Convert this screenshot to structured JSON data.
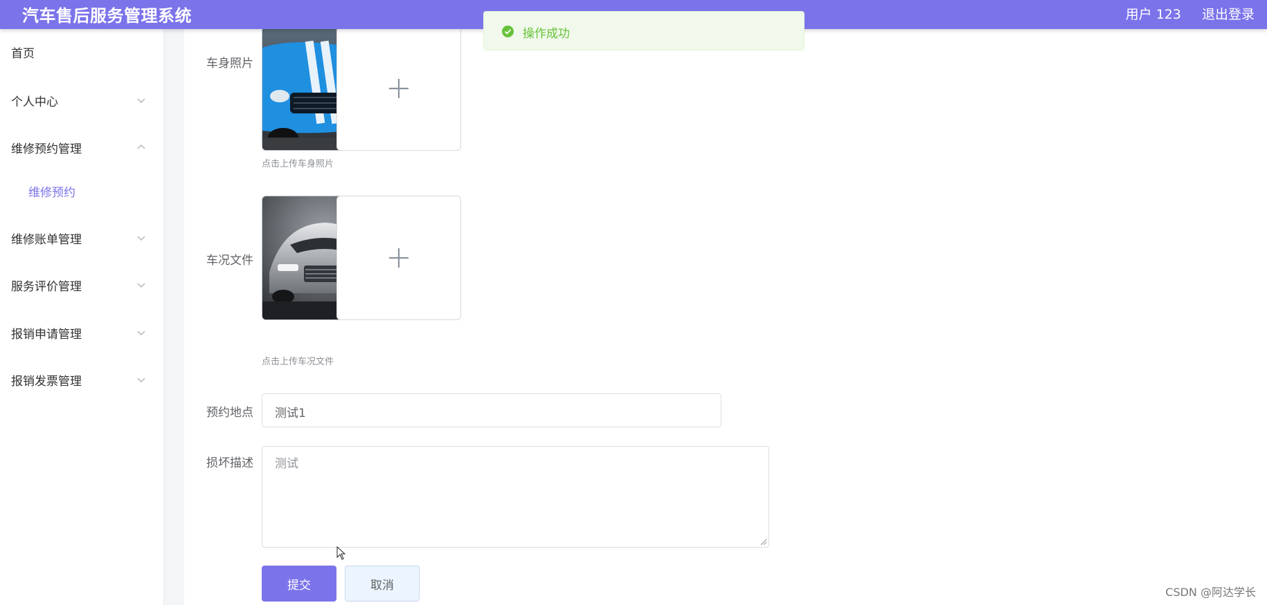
{
  "app": {
    "title": "汽车售后服务管理系统",
    "user_label": "用户 123",
    "logout_label": "退出登录"
  },
  "sidebar": {
    "items": [
      {
        "label": "首页",
        "expandable": false
      },
      {
        "label": "个人中心",
        "expandable": true,
        "icon": "chevron-down-icon"
      },
      {
        "label": "维修预约管理",
        "expandable": true,
        "icon": "chevron-up-icon",
        "expanded": true
      },
      {
        "label": "维修预约",
        "sub": true,
        "active": true
      },
      {
        "label": "维修账单管理",
        "expandable": true,
        "icon": "chevron-down-icon"
      },
      {
        "label": "服务评价管理",
        "expandable": true,
        "icon": "chevron-down-icon"
      },
      {
        "label": "报销申请管理",
        "expandable": true,
        "icon": "chevron-down-icon"
      },
      {
        "label": "报销发票管理",
        "expandable": true,
        "icon": "chevron-down-icon"
      }
    ]
  },
  "form": {
    "body_photo": {
      "label": "车身照片",
      "hint": "点击上传车身照片",
      "image": "blue-sports-car-photo"
    },
    "condition_file": {
      "label": "车况文件",
      "hint": "点击上传车况文件",
      "image": "silver-concept-car-photo",
      "uploaded": true
    },
    "location": {
      "label": "预约地点",
      "value": "测试1"
    },
    "damage": {
      "label": "损坏描述",
      "value": "测试"
    },
    "submit_label": "提交",
    "cancel_label": "取消"
  },
  "toast": {
    "message": "操作成功",
    "type": "success",
    "icon": "check-circle-icon"
  },
  "watermark": "CSDN @阿达学长",
  "colors": {
    "primary": "#7b73ea",
    "success": "#67c23a",
    "success_bg": "#f0f9eb"
  }
}
